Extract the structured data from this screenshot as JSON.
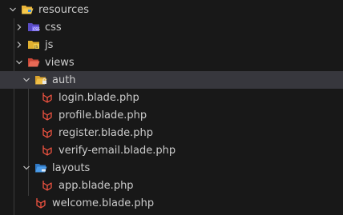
{
  "explorer": {
    "items": [
      {
        "label": "resources",
        "kind": "folder-open",
        "icon": "folder-resources-open-icon",
        "expanded": true,
        "selected": false,
        "depth": 0
      },
      {
        "label": "css",
        "kind": "folder",
        "icon": "folder-css-icon",
        "expanded": false,
        "selected": false,
        "depth": 1
      },
      {
        "label": "js",
        "kind": "folder",
        "icon": "folder-js-icon",
        "expanded": false,
        "selected": false,
        "depth": 1
      },
      {
        "label": "views",
        "kind": "folder-open",
        "icon": "folder-views-open-icon",
        "expanded": true,
        "selected": false,
        "depth": 1
      },
      {
        "label": "auth",
        "kind": "folder-open",
        "icon": "folder-auth-open-icon",
        "expanded": true,
        "selected": true,
        "depth": 2
      },
      {
        "label": "login.blade.php",
        "kind": "file",
        "icon": "laravel-blade-icon",
        "depth": 3
      },
      {
        "label": "profile.blade.php",
        "kind": "file",
        "icon": "laravel-blade-icon",
        "depth": 3
      },
      {
        "label": "register.blade.php",
        "kind": "file",
        "icon": "laravel-blade-icon",
        "depth": 3
      },
      {
        "label": "verify-email.blade.php",
        "kind": "file",
        "icon": "laravel-blade-icon",
        "depth": 3
      },
      {
        "label": "layouts",
        "kind": "folder-open",
        "icon": "folder-layouts-open-icon",
        "expanded": true,
        "selected": false,
        "depth": 2
      },
      {
        "label": "app.blade.php",
        "kind": "file",
        "icon": "laravel-blade-icon",
        "depth": 3
      },
      {
        "label": "welcome.blade.php",
        "kind": "file",
        "icon": "laravel-blade-icon",
        "depth": 2
      }
    ]
  },
  "colors": {
    "background": "#181818",
    "selected_row": "#37373d",
    "text": "#cccccc",
    "laravel_red": "#f05340",
    "folder_yellow": "#e8b33a",
    "folder_views": "#e05a4a",
    "folder_css": "#6b5bd6",
    "folder_layouts": "#3d8ee0"
  }
}
